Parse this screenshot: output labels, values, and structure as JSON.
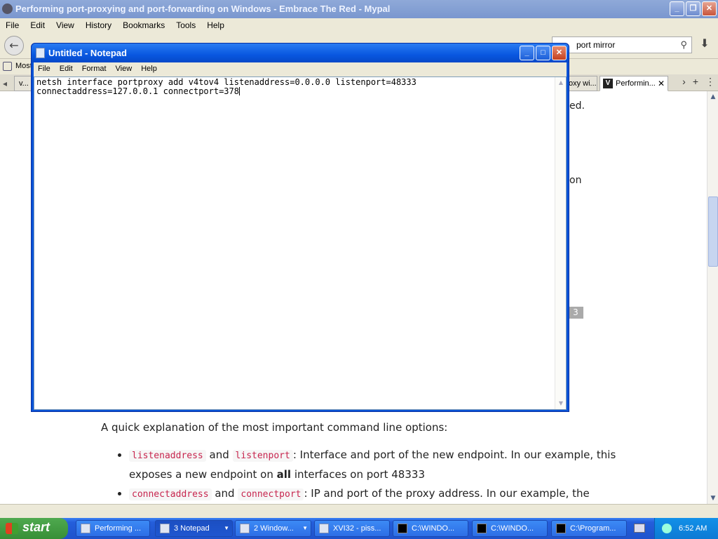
{
  "browser": {
    "title": "Performing port-proxying and port-forwarding on Windows - Embrace The Red - Mypal",
    "menu": [
      "File",
      "Edit",
      "View",
      "History",
      "Bookmarks",
      "Tools",
      "Help"
    ],
    "search_value": "port mirror",
    "bookmarks_label": "Most",
    "tabs": {
      "left_tab": "v...",
      "tab_2": "oxy wi...",
      "active_tab": "Performin..."
    },
    "content": {
      "peek_1": "ed.",
      "peek_2": "on",
      "peek_badge": "3",
      "explain": "A quick explanation of the most important command line options:",
      "b1_code1": "listenaddress",
      "b1_and": "and",
      "b1_code2": "listenport",
      "b1_text": ": Interface and port of the new endpoint. In our example, this exposes a new endpoint on ",
      "b1_bold": "all",
      "b1_tail": " interfaces on port 48333",
      "b2_code1": "connectaddress",
      "b2_and": "and",
      "b2_code2": "connectport",
      "b2_text": ": IP and port of the proxy address. In our example, the"
    }
  },
  "notepad": {
    "title": "Untitled - Notepad",
    "menu": [
      "File",
      "Edit",
      "Format",
      "View",
      "Help"
    ],
    "line1": "netsh interface portproxy add v4tov4 listenaddress=0.0.0.0 listenport=48333",
    "line2": "connectaddress=127.0.0.1 connectport=378"
  },
  "taskbar": {
    "start": "start",
    "items": [
      "Performing ...",
      "3 Notepad",
      "2 Window...",
      "XVI32 - piss...",
      "C:\\WINDO...",
      "C:\\WINDO...",
      "C:\\Program..."
    ],
    "clock": "6:52 AM"
  },
  "colors": {
    "notepad_title": "#0857e0",
    "taskbar": "#245edb",
    "start": "#378f37",
    "code_text": "#c7254e"
  }
}
